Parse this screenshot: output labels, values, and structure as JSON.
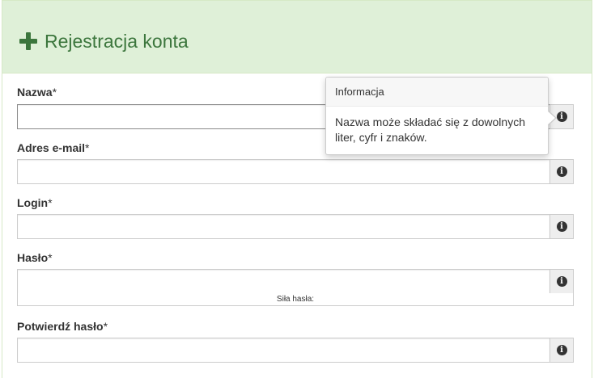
{
  "header": {
    "title": "Rejestracja konta",
    "icon": "plus-icon",
    "color": "#3c763d",
    "background": "#dff0d8"
  },
  "fields": [
    {
      "label": "Nazwa",
      "required_mark": "*",
      "value": "",
      "info_icon": "info-circle-icon"
    },
    {
      "label": "Adres e-mail",
      "required_mark": "*",
      "value": "",
      "info_icon": "info-circle-icon"
    },
    {
      "label": "Login",
      "required_mark": "*",
      "value": "",
      "info_icon": "info-circle-icon"
    },
    {
      "label": "Hasło",
      "required_mark": "*",
      "value": "",
      "info_icon": "info-circle-icon"
    },
    {
      "label": "Potwierdź hasło",
      "required_mark": "*",
      "value": "",
      "info_icon": "info-circle-icon"
    }
  ],
  "password_strength": {
    "label": "Siła hasła:"
  },
  "popover": {
    "title": "Informacja",
    "content": "Nazwa może składać się z dowolnych liter, cyfr i znaków."
  },
  "info_glyph": "i"
}
